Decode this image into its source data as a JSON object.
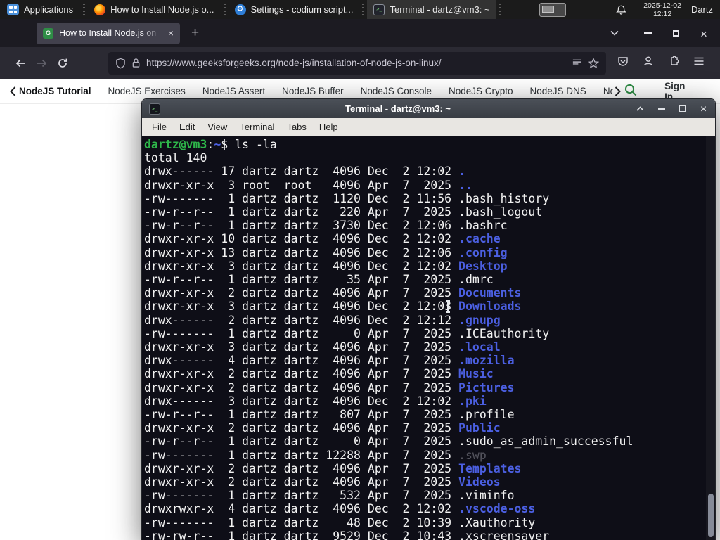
{
  "panel": {
    "applications_label": "Applications",
    "tasks": [
      {
        "title": "How to Install Node.js o...",
        "icon": "firefox",
        "active": false
      },
      {
        "title": "Settings - codium script...",
        "icon": "settings",
        "active": false
      },
      {
        "title": "Terminal - dartz@vm3: ~",
        "icon": "terminal",
        "active": true
      }
    ],
    "clock_date": "2025-12-02",
    "clock_time": "12:12",
    "user_label": "Dartz"
  },
  "glyphs": {
    "close_x": "×",
    "new_tab": "+"
  },
  "browser": {
    "tab_title": "How to Install Node.js on",
    "url": "https://www.geeksforgeeks.org/node-js/installation-of-node-js-on-linux/",
    "gfg_nav": {
      "items": [
        "NodeJS Tutorial",
        "NodeJS Exercises",
        "NodeJS Assert",
        "NodeJS Buffer",
        "NodeJS Console",
        "NodeJS Crypto",
        "NodeJS DNS",
        "Node"
      ],
      "sign_in_label": "Sign In"
    }
  },
  "terminal": {
    "window_title": "Terminal - dartz@vm3: ~",
    "menu_items": [
      "File",
      "Edit",
      "View",
      "Terminal",
      "Tabs",
      "Help"
    ],
    "prompt_user_host": "dartz@vm3",
    "prompt_colon": ":",
    "prompt_path": "~",
    "prompt_dollar": "$ ",
    "command": "ls -la",
    "total_line": "total 140",
    "listing": [
      {
        "pre": "drwx------ 17 dartz dartz  4096 Dec  2 12:02 ",
        "name": ".",
        "type": "dir"
      },
      {
        "pre": "drwxr-xr-x  3 root  root   4096 Apr  7  2025 ",
        "name": "..",
        "type": "dir"
      },
      {
        "pre": "-rw-------  1 dartz dartz  1120 Dec  2 11:56 ",
        "name": ".bash_history",
        "type": "file"
      },
      {
        "pre": "-rw-r--r--  1 dartz dartz   220 Apr  7  2025 ",
        "name": ".bash_logout",
        "type": "file"
      },
      {
        "pre": "-rw-r--r--  1 dartz dartz  3730 Dec  2 12:06 ",
        "name": ".bashrc",
        "type": "file"
      },
      {
        "pre": "drwxr-xr-x 10 dartz dartz  4096 Dec  2 12:02 ",
        "name": ".cache",
        "type": "dir"
      },
      {
        "pre": "drwxr-xr-x 13 dartz dartz  4096 Dec  2 12:06 ",
        "name": ".config",
        "type": "dir"
      },
      {
        "pre": "drwxr-xr-x  3 dartz dartz  4096 Dec  2 12:02 ",
        "name": "Desktop",
        "type": "dir"
      },
      {
        "pre": "-rw-r--r--  1 dartz dartz    35 Apr  7  2025 ",
        "name": ".dmrc",
        "type": "file"
      },
      {
        "pre": "drwxr-xr-x  2 dartz dartz  4096 Apr  7  2025 ",
        "name": "Documents",
        "type": "dir"
      },
      {
        "pre": "drwxr-xr-x  3 dartz dartz  4096 Dec  2 12:03 ",
        "name": "Downloads",
        "type": "dir"
      },
      {
        "pre": "drwx------  2 dartz dartz  4096 Dec  2 12:12 ",
        "name": ".gnupg",
        "type": "dir"
      },
      {
        "pre": "-rw-------  1 dartz dartz     0 Apr  7  2025 ",
        "name": ".ICEauthority",
        "type": "file"
      },
      {
        "pre": "drwxr-xr-x  3 dartz dartz  4096 Apr  7  2025 ",
        "name": ".local",
        "type": "dir"
      },
      {
        "pre": "drwx------  4 dartz dartz  4096 Apr  7  2025 ",
        "name": ".mozilla",
        "type": "dir"
      },
      {
        "pre": "drwxr-xr-x  2 dartz dartz  4096 Apr  7  2025 ",
        "name": "Music",
        "type": "dir"
      },
      {
        "pre": "drwxr-xr-x  2 dartz dartz  4096 Apr  7  2025 ",
        "name": "Pictures",
        "type": "dir"
      },
      {
        "pre": "drwx------  3 dartz dartz  4096 Dec  2 12:02 ",
        "name": ".pki",
        "type": "dir"
      },
      {
        "pre": "-rw-r--r--  1 dartz dartz   807 Apr  7  2025 ",
        "name": ".profile",
        "type": "file"
      },
      {
        "pre": "drwxr-xr-x  2 dartz dartz  4096 Apr  7  2025 ",
        "name": "Public",
        "type": "dir"
      },
      {
        "pre": "-rw-r--r--  1 dartz dartz     0 Apr  7  2025 ",
        "name": ".sudo_as_admin_successful",
        "type": "file"
      },
      {
        "pre": "-rw-------  1 dartz dartz 12288 Apr  7  2025 ",
        "name": ".swp",
        "type": "dim"
      },
      {
        "pre": "drwxr-xr-x  2 dartz dartz  4096 Apr  7  2025 ",
        "name": "Templates",
        "type": "dir"
      },
      {
        "pre": "drwxr-xr-x  2 dartz dartz  4096 Apr  7  2025 ",
        "name": "Videos",
        "type": "dir"
      },
      {
        "pre": "-rw-------  1 dartz dartz   532 Apr  7  2025 ",
        "name": ".viminfo",
        "type": "file"
      },
      {
        "pre": "drwxrwxr-x  4 dartz dartz  4096 Dec  2 12:02 ",
        "name": ".vscode-oss",
        "type": "dir"
      },
      {
        "pre": "-rw-------  1 dartz dartz    48 Dec  2 10:39 ",
        "name": ".Xauthority",
        "type": "file"
      },
      {
        "pre": "-rw-rw-r--  1 dartz dartz  9529 Dec  2 10:43 ",
        "name": ".xscreensaver",
        "type": "file"
      }
    ]
  },
  "colors": {
    "gfg_green": "#2f8d46",
    "terminal_prompt_green": "#2eb74a",
    "terminal_dir_blue": "#4b5fe1",
    "terminal_bg": "#0e0e17",
    "panel_bg": "#1b1b1b",
    "firefox_toolbar_bg": "#2b2a33"
  }
}
